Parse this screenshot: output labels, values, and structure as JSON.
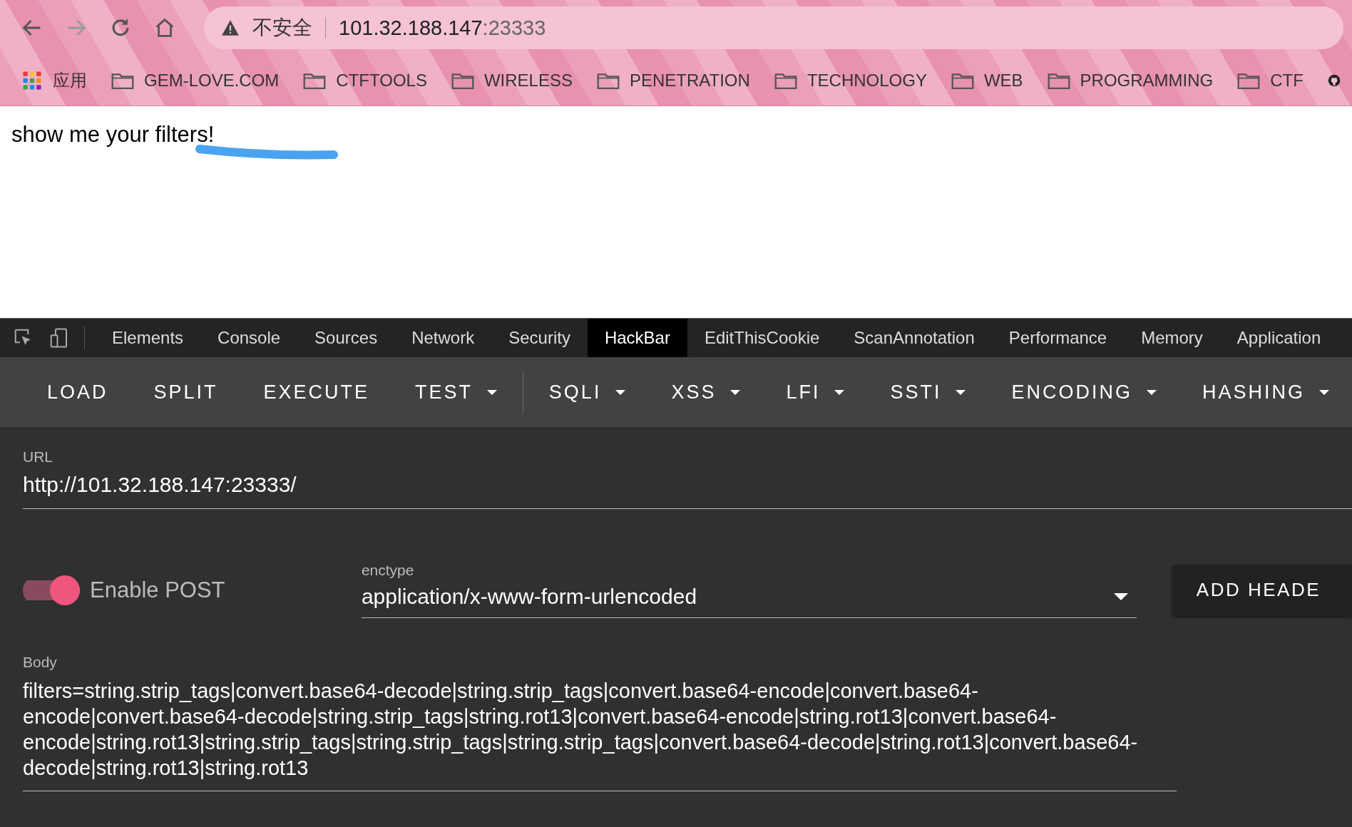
{
  "browser": {
    "security_label": "不安全",
    "address_host": "101.32.188.147",
    "address_port": ":23333"
  },
  "bookmarks": [
    {
      "kind": "apps",
      "label": "应用"
    },
    {
      "kind": "folder",
      "label": "GEM-LOVE.COM"
    },
    {
      "kind": "folder",
      "label": "CTFTOOLS"
    },
    {
      "kind": "folder",
      "label": "WIRELESS"
    },
    {
      "kind": "folder",
      "label": "PENETRATION"
    },
    {
      "kind": "folder",
      "label": "TECHNOLOGY"
    },
    {
      "kind": "folder",
      "label": "WEB"
    },
    {
      "kind": "folder",
      "label": "PROGRAMMING"
    },
    {
      "kind": "folder",
      "label": "CTF"
    },
    {
      "kind": "github"
    }
  ],
  "page": {
    "text": "show me your filters!"
  },
  "devtools_tabs": [
    {
      "label": "Elements",
      "selected": false
    },
    {
      "label": "Console",
      "selected": false
    },
    {
      "label": "Sources",
      "selected": false
    },
    {
      "label": "Network",
      "selected": false
    },
    {
      "label": "Security",
      "selected": false
    },
    {
      "label": "HackBar",
      "selected": true
    },
    {
      "label": "EditThisCookie",
      "selected": false
    },
    {
      "label": "ScanAnnotation",
      "selected": false
    },
    {
      "label": "Performance",
      "selected": false
    },
    {
      "label": "Memory",
      "selected": false
    },
    {
      "label": "Application",
      "selected": false
    }
  ],
  "hackbar_toolbar": [
    [
      {
        "label": "LOAD",
        "kind": "button"
      },
      {
        "label": "SPLIT",
        "kind": "button"
      },
      {
        "label": "EXECUTE",
        "kind": "button"
      },
      {
        "label": "TEST",
        "kind": "menu"
      }
    ],
    [
      {
        "label": "SQLI",
        "kind": "menu"
      },
      {
        "label": "XSS",
        "kind": "menu"
      },
      {
        "label": "LFI",
        "kind": "menu"
      },
      {
        "label": "SSTI",
        "kind": "menu"
      },
      {
        "label": "ENCODING",
        "kind": "menu"
      },
      {
        "label": "HASHING",
        "kind": "menu"
      }
    ]
  ],
  "url": {
    "label": "URL",
    "value": "http://101.32.188.147:23333/"
  },
  "post": {
    "label": "Enable POST",
    "on": true
  },
  "enctype": {
    "label": "enctype",
    "value": "application/x-www-form-urlencoded"
  },
  "add_header_button": "ADD HEADE",
  "body": {
    "label": "Body",
    "value": "filters=string.strip_tags|convert.base64-decode|string.strip_tags|convert.base64-encode|convert.base64-encode|convert.base64-decode|string.strip_tags|string.rot13|convert.base64-encode|string.rot13|convert.base64-encode|string.rot13|string.strip_tags|string.strip_tags|string.strip_tags|convert.base64-decode|string.rot13|convert.base64-decode|string.rot13|string.rot13"
  }
}
